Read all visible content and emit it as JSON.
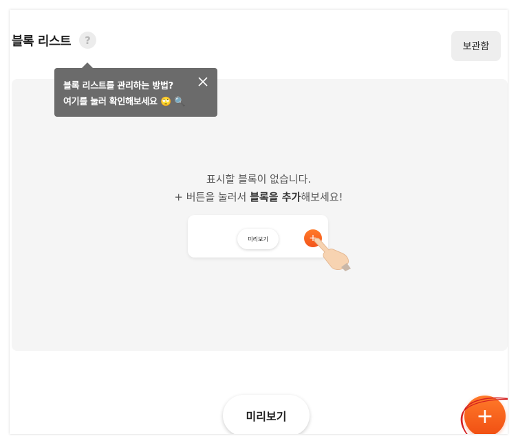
{
  "header": {
    "title": "블록 리스트",
    "help_glyph": "?",
    "archive_label": "보관함"
  },
  "tooltip": {
    "line1": "블록 리스트를 관리하는 방법?",
    "line2_prefix": "여기를 눌러 확인해보세요",
    "emoji_face": "🙄",
    "emoji_magnifier": "🔍",
    "close_icon": "close-icon"
  },
  "empty_state": {
    "line1": "표시할 블록이 없습니다.",
    "line2_part1": "+ 버튼을 눌러서 ",
    "line2_bold1": "블록을 추가",
    "line2_part2": "해보세요!",
    "illustration": {
      "preview_label": "미리보기",
      "plus_glyph": "+"
    }
  },
  "bottom": {
    "preview_label": "미리보기",
    "add_glyph": "+"
  },
  "colors": {
    "accent": "#f3541b",
    "tooltip_bg": "#6b6b6b",
    "panel_bg": "#f5f5f5",
    "annotation_red": "#d42020"
  }
}
